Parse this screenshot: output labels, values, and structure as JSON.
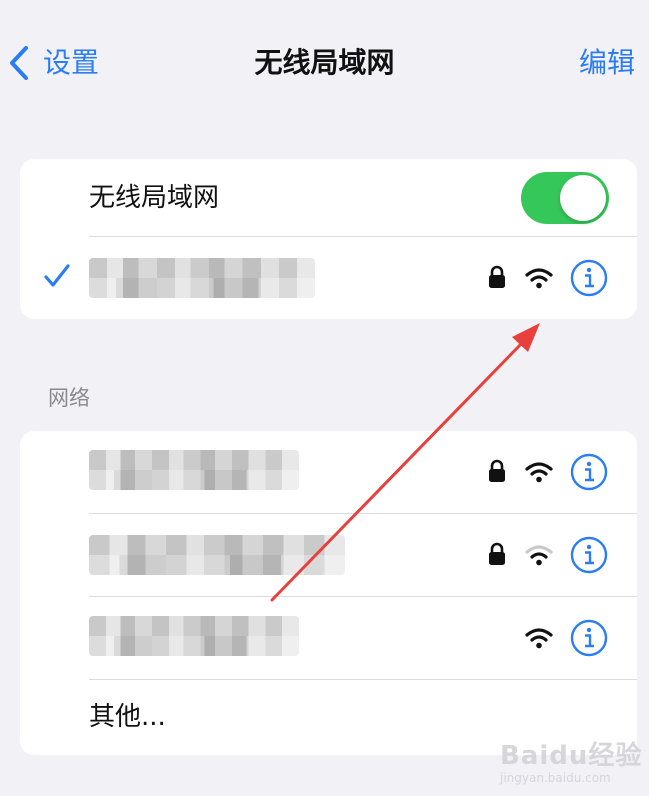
{
  "nav": {
    "back_label": "设置",
    "title": "无线局域网",
    "edit_label": "编辑"
  },
  "wifi_toggle": {
    "label": "无线局域网",
    "on": true
  },
  "connected_network": {
    "name": "",
    "secured": true,
    "selected": true
  },
  "networks_section": {
    "header": "网络",
    "items": [
      {
        "name": "",
        "secured": true,
        "signal": "full"
      },
      {
        "name": "",
        "secured": true,
        "signal": "weak"
      },
      {
        "name": "",
        "secured": false,
        "signal": "full"
      }
    ],
    "other_label": "其他..."
  },
  "colors": {
    "accent": "#2a7df2",
    "toggle_on": "#35c759",
    "annotation_arrow": "#e8403d"
  },
  "icons": [
    "chevron-left-icon",
    "checkmark-icon",
    "lock-icon",
    "wifi-icon",
    "info-icon"
  ],
  "watermark": {
    "brand": "Baidu经验",
    "url": "jingyan.baidu.com"
  }
}
